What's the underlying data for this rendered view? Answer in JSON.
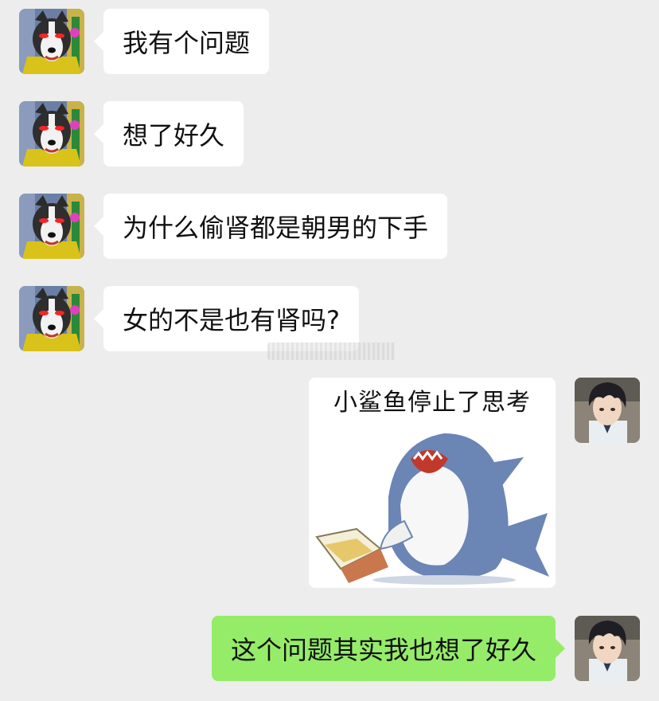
{
  "messages": [
    {
      "side": "left",
      "text": "我有个问题"
    },
    {
      "side": "left",
      "text": "想了好久"
    },
    {
      "side": "left",
      "text": "为什么偷肾都是朝男的下手"
    },
    {
      "side": "left",
      "text": "女的不是也有肾吗?"
    },
    {
      "side": "right",
      "type": "sticker",
      "caption": "小鲨鱼停止了思考"
    },
    {
      "side": "right",
      "text": "这个问题其实我也想了好久"
    }
  ],
  "colors": {
    "background": "#ededed",
    "incoming_bubble": "#ffffff",
    "outgoing_bubble": "#95ec69"
  },
  "avatars": {
    "left": "husky-avatar-icon",
    "right": "anime-boy-avatar-icon"
  }
}
